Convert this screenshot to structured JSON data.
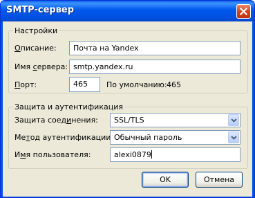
{
  "window": {
    "title": "SMTP-сервер"
  },
  "settings": {
    "legend": "Настройки",
    "description_label_u": "О",
    "description_label_rest": "писание:",
    "description_value": "Почта на Yandex",
    "server_label_pre": "Имя ",
    "server_label_u": "с",
    "server_label_rest": "ервера:",
    "server_value": "smtp.yandex.ru",
    "port_label_u": "П",
    "port_label_rest": "орт:",
    "port_value": "465",
    "default_label": "По умолчанию:",
    "default_value": "465"
  },
  "security": {
    "legend": "Защита и аутентификация",
    "connection_label_pre": "Защита соед",
    "connection_label_u": "и",
    "connection_label_rest": "нения:",
    "connection_value": "SSL/TLS",
    "auth_label_pre": "Ме",
    "auth_label_u": "т",
    "auth_label_rest": "од аутентификации:",
    "auth_value": "Обычный пароль",
    "user_label_pre": "И",
    "user_label_u": "м",
    "user_label_rest": "я пользователя:",
    "user_value": "alexi0879"
  },
  "buttons": {
    "ok": "OK",
    "cancel": "Отмена"
  },
  "colors": {
    "title_bar": "#0054e3",
    "close_button": "#d2401c",
    "dialog_bg": "#ece9d8"
  },
  "icons": {
    "close": "close-icon",
    "dropdown": "chevron-down-icon"
  }
}
